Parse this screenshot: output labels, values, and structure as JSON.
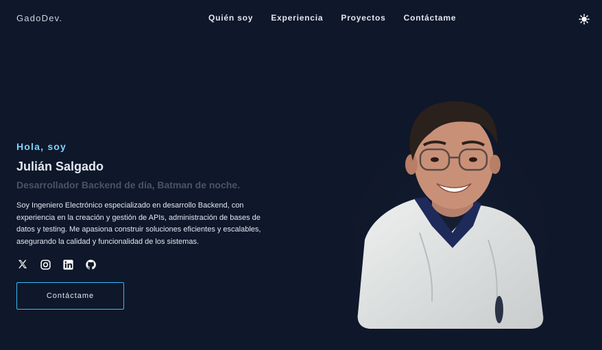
{
  "nav": {
    "logo": "GadoDev.",
    "links": [
      "Quién soy",
      "Experiencia",
      "Proyectos",
      "Contáctame"
    ],
    "theme_icon": "sun-icon"
  },
  "hero": {
    "greeting": "Hola, soy",
    "name": "Julián Salgado",
    "tagline": "Desarrollador Backend de día, Batman de noche.",
    "bio": "Soy Ingeniero Electrónico especializado en desarrollo Backend, con experiencia en la creación y gestión de APIs, administración de bases de datos y testing. Me apasiona construir soluciones eficientes y escalables, asegurando la calidad y funcionalidad de los sistemas.",
    "socials": [
      "x-icon",
      "instagram-icon",
      "linkedin-icon",
      "github-icon"
    ],
    "cta_label": "Contáctame"
  },
  "colors": {
    "background": "#0f172a",
    "accent": "#38bdf8",
    "greeting": "#7dd3fc",
    "muted": "#475569"
  }
}
